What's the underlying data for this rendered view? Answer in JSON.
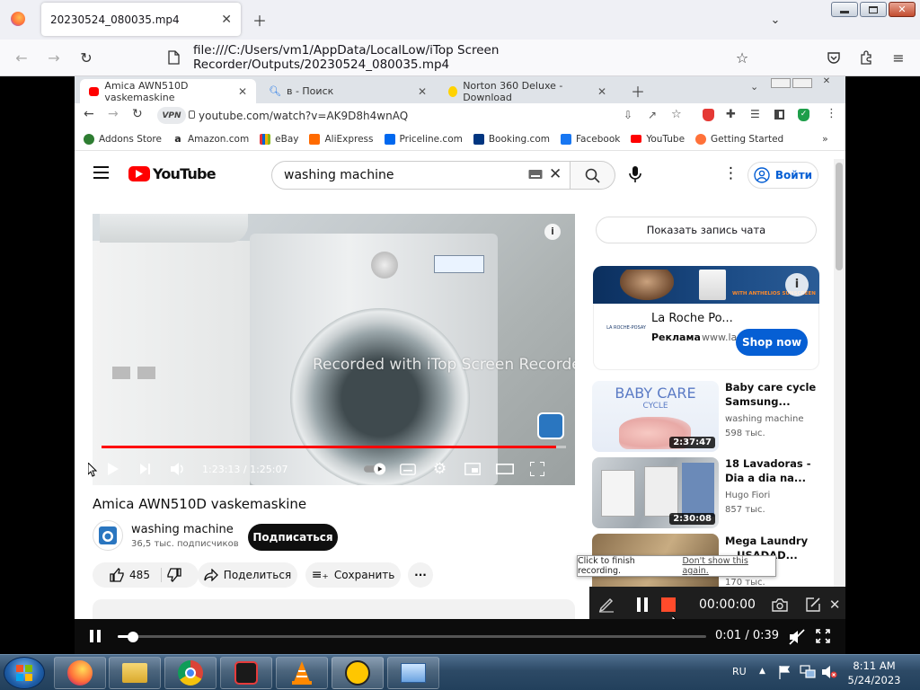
{
  "firefox": {
    "tab_title": "20230524_080035.mp4",
    "url": "file:///C:/Users/vm1/AppData/LocalLow/iTop Screen Recorder/Outputs/20230524_080035.mp4"
  },
  "chrome": {
    "tabs": [
      {
        "label": "Amica AWN510D vaskemaskine"
      },
      {
        "label": "в - Поиск"
      },
      {
        "label": "Norton 360 Deluxe - Download"
      }
    ],
    "vpn_badge": "VPN",
    "url": "youtube.com/watch?v=AK9D8h4wnAQ",
    "bookmarks": [
      {
        "label": "Addons Store",
        "color": "#2e7d32"
      },
      {
        "label": "Amazon.com",
        "color": "#222222"
      },
      {
        "label": "eBay",
        "color": "#e53238"
      },
      {
        "label": "AliExpress",
        "color": "#ff6a00"
      },
      {
        "label": "Priceline.com",
        "color": "#0068ef"
      },
      {
        "label": "Booking.com",
        "color": "#003580"
      },
      {
        "label": "Facebook",
        "color": "#1877f2"
      },
      {
        "label": "YouTube",
        "color": "#ff0000"
      },
      {
        "label": "Getting Started",
        "color": "#ff7139"
      }
    ]
  },
  "youtube": {
    "logo_text": "YouTube",
    "search_value": "washing machine",
    "signin_label": "Войти",
    "video_watermark": "Recorded with iTop Screen Recorder",
    "time": "1:23:13 / 1:25:07",
    "progress_fraction": 0.978,
    "video_title": "Amica AWN510D vaskemaskine",
    "channel_name": "washing machine",
    "subscribers": "36,5 тыс. подписчиков",
    "subscribe_label": "Подписаться",
    "likes": "485",
    "share_label": "Поделиться",
    "save_label": "Сохранить",
    "chat_label": "Показать запись чата",
    "ad": {
      "banner_text": "WITH ANTHELIOS SUNSCREEN",
      "title": "La Roche Po...",
      "ad_label": "Реклама",
      "domain": "· www.la",
      "cta": "Shop now",
      "logo_text": "LA ROCHE-POSAY"
    },
    "recommendations": [
      {
        "title": "Baby care cycle Samsung...",
        "channel": "washing machine",
        "views": "598 тыс.",
        "duration": "2:37:47",
        "thumb_text": "BABY CARE",
        "thumb_sub": "CYCLE"
      },
      {
        "title": "18 Lavadoras - Dia a dia na...",
        "channel": "Hugo Fiori",
        "views": "857 тыс.",
        "duration": "2:30:08"
      },
      {
        "title": "Mega Laundry ...USADAD...",
        "channel": "",
        "views": "170 тыс.",
        "duration": ""
      }
    ]
  },
  "recorder": {
    "tooltip_text": "Click to finish recording.",
    "tooltip_link": "Don't show this again.",
    "timer": "00:00:00",
    "record_color": "#ff4b2b"
  },
  "media_player": {
    "time": "0:01 / 0:39",
    "progress_fraction": 0.026
  },
  "taskbar": {
    "lang": "RU",
    "time": "8:11 AM",
    "date": "5/24/2023"
  }
}
